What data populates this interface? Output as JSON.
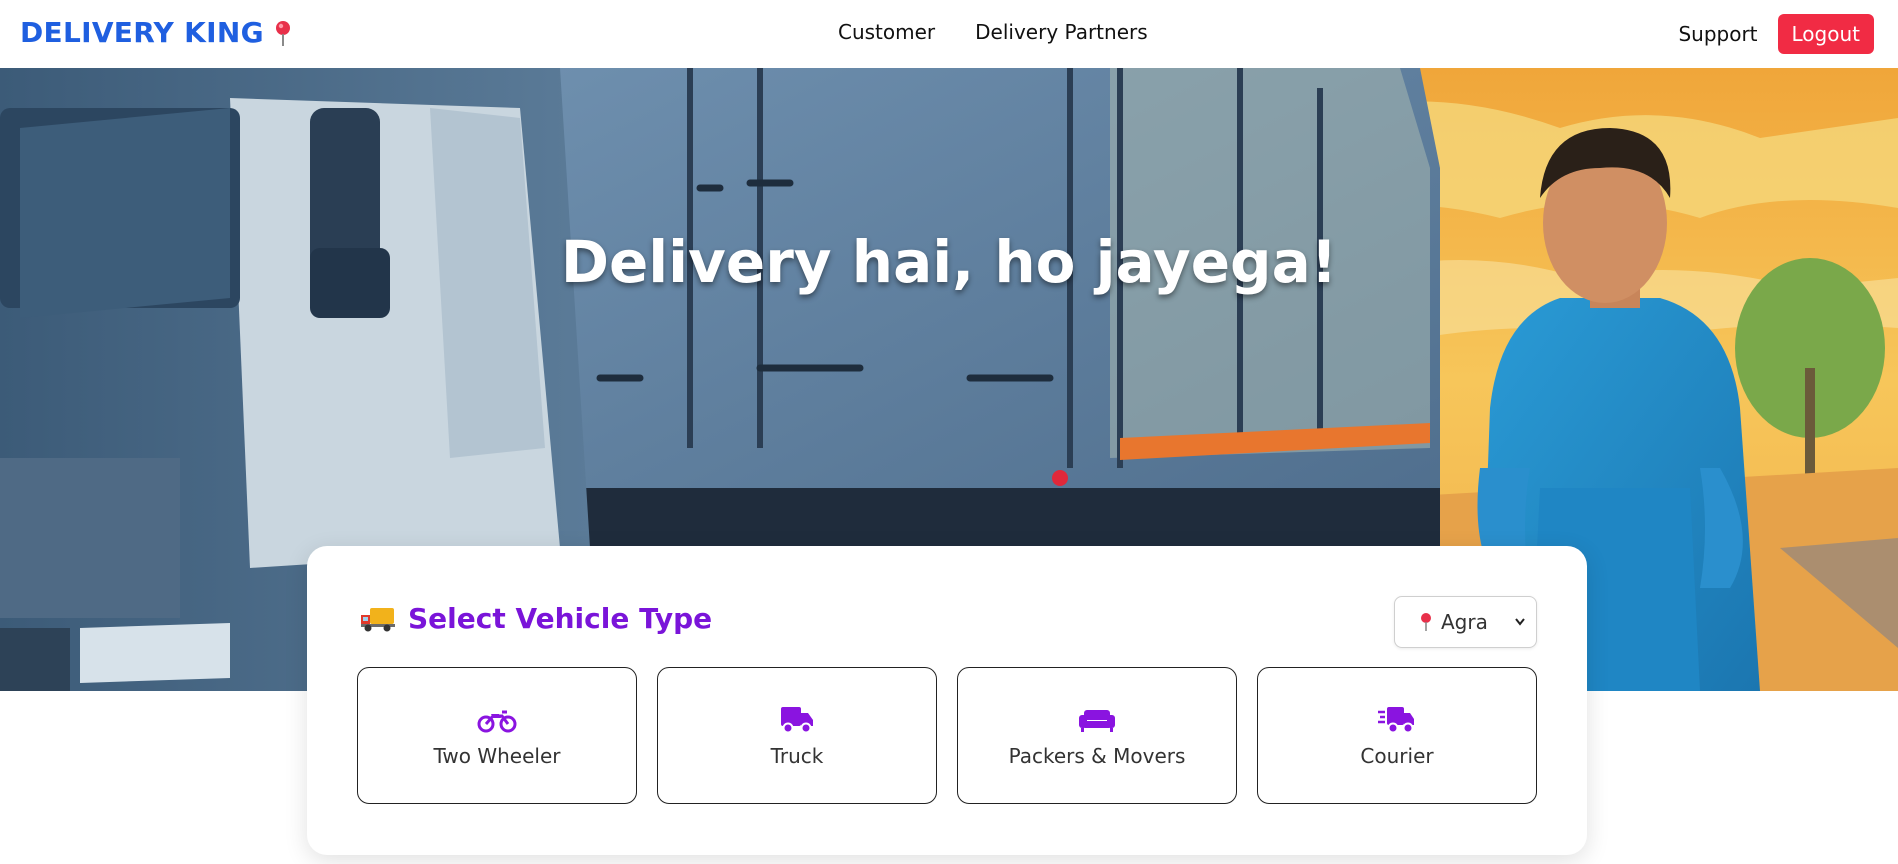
{
  "navbar": {
    "brand": "DELIVERY KING",
    "links": [
      "Customer",
      "Delivery Partners"
    ],
    "support": "Support",
    "logout": "Logout"
  },
  "hero": {
    "title": "Delivery hai, ho jayega!"
  },
  "vehicle_card": {
    "title": "Select Vehicle Type",
    "city_selected": "Agra",
    "options": [
      {
        "label": "Two Wheeler",
        "icon": "motorcycle-icon"
      },
      {
        "label": "Truck",
        "icon": "truck-icon"
      },
      {
        "label": "Packers & Movers",
        "icon": "sofa-icon"
      },
      {
        "label": "Courier",
        "icon": "fast-truck-icon"
      }
    ]
  },
  "colors": {
    "brand": "#1f5fe0",
    "accent": "#7a14d9",
    "logout": "#f12b44"
  }
}
